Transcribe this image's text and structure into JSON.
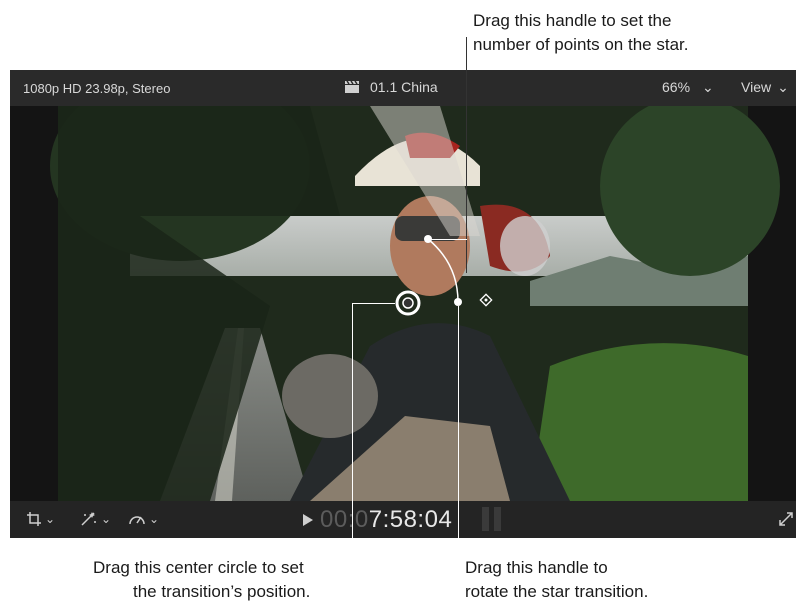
{
  "callouts": {
    "top_line1": "Drag this handle to set the",
    "top_line2": "number of points on the star.",
    "left_line1": "Drag this center circle to set",
    "left_line2": "the transition’s position.",
    "right_line1": "Drag this handle to",
    "right_line2": "rotate the star transition."
  },
  "viewer": {
    "format": "1080p HD 23.98p, Stereo",
    "clip_name": "01.1 China",
    "zoom": "66%",
    "view_label": "View"
  },
  "playback": {
    "timecode_dim": "00:0",
    "timecode": "7:58:04"
  },
  "icons": {
    "clapper": "clapperboard-icon",
    "crop": "crop-icon",
    "transform": "transform-icon",
    "speed": "speed-icon",
    "play": "play-icon",
    "expand": "fullscreen-icon"
  }
}
